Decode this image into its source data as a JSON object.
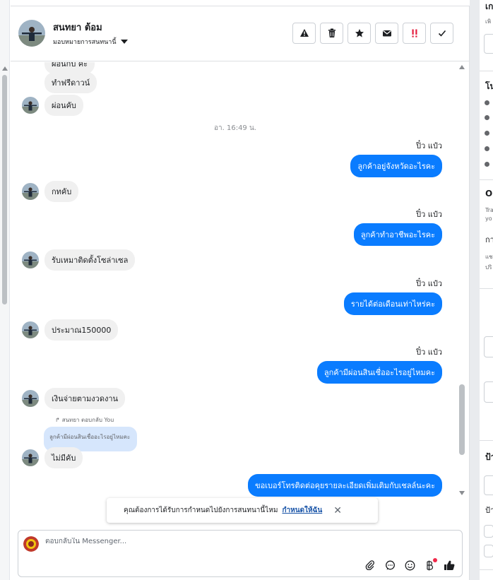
{
  "header": {
    "contact_name": "สนทยา ต้อม",
    "assign_label": "มอบหมายการสนทนานี้",
    "actions": [
      {
        "name": "spam-button",
        "icon": "warning-triangle-icon"
      },
      {
        "name": "delete-button",
        "icon": "trash-icon"
      },
      {
        "name": "star-button",
        "icon": "star-icon"
      },
      {
        "name": "mark-unread-button",
        "icon": "envelope-icon"
      },
      {
        "name": "follow-up-button",
        "icon": "exclamation-icon"
      },
      {
        "name": "done-button",
        "icon": "check-icon"
      }
    ]
  },
  "conversation": {
    "in_1_partial": "ผ่อนกี่ปี ค่ะ",
    "in_2": "ทำฟรีดาวน์",
    "in_3": "ผ่อนคับ",
    "timestamp": "อา. 16:49 น.",
    "out_1_sender": "ปิ๋ว แป๋ว",
    "out_1": "ลูกค้าอยู่จังหวัดอะไรคะ",
    "in_4": "กทคับ",
    "out_2_sender": "ปิ๋ว แป๋ว",
    "out_2": "ลูกค้าทำอาชีพอะไรคะ",
    "in_5": "รับเหมาติดตั้งโซล่าเซล",
    "out_3_sender": "ปิ๋ว แป๋ว",
    "out_3": "รายได้ต่อเดือนเท่าไหร่คะ",
    "in_6": "ประมาณ150000",
    "out_4_sender": "ปิ๋ว แป๋ว",
    "out_4": "ลูกค้ามีผ่อนสินเชื่ออะไรอยู่ไหมคะ",
    "in_7": "เงินจ่ายตามงวดงาน",
    "reply_meta": "สนทยา ตอบกลับ You",
    "quoted_text": "ลูกค้ามีผ่อนสินเชื่ออะไรอยู่ไหมคะ",
    "in_8": "ไม่มีคับ",
    "out_5": "ขอเบอร์โทรติดต่อคุยรายละเอียดเพิ่มเติมกับเชลล์นะคะ"
  },
  "toast": {
    "message": "คุณต้องการได้รับการกำหนดไปยังการสนทนานี้ไหม",
    "link": "กำหนดให้ฉัน"
  },
  "composer": {
    "placeholder": "ตอบกลับใน Messenger..."
  },
  "right_panel": {
    "frag_1": "เก",
    "frag_2": "เพิ",
    "frag_3": "โน",
    "frag_4": "On",
    "frag_5": "Tra",
    "frag_6": "yo",
    "frag_7": "กา",
    "frag_8": "แช",
    "frag_9": "ปริ",
    "frag_10": "ป้า",
    "frag_11": "ป้า"
  },
  "colors": {
    "outgoing_bubble": "#0a7cff",
    "incoming_bubble": "#f0f0f0",
    "quoted_bubble": "#d6e6fc",
    "link": "#1a55a8"
  }
}
